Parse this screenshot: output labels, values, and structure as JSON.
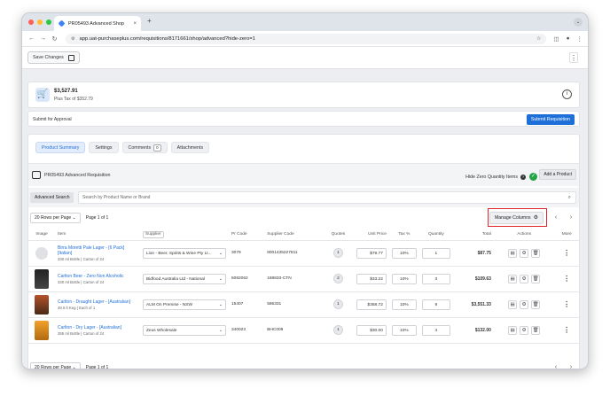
{
  "browser": {
    "tab_title": "PR05493 Advanced Shop",
    "tab_close": "×",
    "new_tab": "+",
    "url": "app.uat-purchaseplus.com/requisitions/8171661/shop/advanced?hide-zero=1"
  },
  "topbar": {
    "save_label": "Save Changes",
    "menu": "⋮"
  },
  "summary": {
    "amount": "$3,527.91",
    "tax": "Plus Tax of $352.79",
    "info": "i"
  },
  "approval": {
    "label": "Submit for Approval",
    "submit_label": "Submit Requisition"
  },
  "tabs": [
    {
      "label": "Product Summary"
    },
    {
      "label": "Settings"
    },
    {
      "label": "Comments",
      "badge": "0"
    },
    {
      "label": "Attachments"
    }
  ],
  "requisition": {
    "title": "PR05493 Advanced Requisition",
    "hide_zero_label": "Hide Zero Quantity Items",
    "add_product_label": "Add a Product"
  },
  "search": {
    "advanced_label": "Advanced Search",
    "placeholder": "Search by Product Name or Brand"
  },
  "pager": {
    "rows_label": "20 Rows per Page",
    "page_label": "Page 1 of 1",
    "manage_columns_label": "Manage Columns"
  },
  "columns": {
    "image": "Image",
    "item": "Item",
    "supplier": "Supplier",
    "pr_code": "Pr Code",
    "supplier_code": "Supplier Code",
    "quotes": "Quotes",
    "unit_price": "Unit Price",
    "tax": "Tax %",
    "quantity": "Quantity",
    "total": "Total",
    "actions": "Actions",
    "more": "More"
  },
  "rows": [
    {
      "name": "Birra Moretti Pale Lager - [6 Pack] [Italian]",
      "sub": "330 ml Bottle | Carton of 24",
      "supplier": "Lion - Beer, Spirits & Wine Pty Lt...",
      "pr_code": "3079",
      "supplier_code": "8001435227811",
      "quotes": "1",
      "unit_price": "$79.77",
      "tax": "10%",
      "quantity": "1",
      "total": "$87.75"
    },
    {
      "name": "Carlton Beer - Zero Non Alcoholic",
      "sub": "330 ml Bottle | Carton of 24",
      "supplier": "Bidfood Australia Ltd - National",
      "pr_code": "5082062",
      "supplier_code": "188833-CTN",
      "quotes": "2",
      "unit_price": "$33.22",
      "tax": "10%",
      "quantity": "3",
      "total": "$109.63"
    },
    {
      "name": "Carlton - Draught Lager - [Australian]",
      "sub": "49.5 lt Keg | Each of 1",
      "supplier": "ALM On Premise - NSW",
      "pr_code": "15407",
      "supplier_code": "586331",
      "quotes": "1",
      "unit_price": "$358.72",
      "tax": "10%",
      "quantity": "9",
      "total": "$3,551.33"
    },
    {
      "name": "Carlton - Dry Lager - [Australian]",
      "sub": "355 ml Bottle | Carton of 24",
      "supplier": "Zeus Wholesale",
      "pr_code": "340023",
      "supplier_code": "BHC009",
      "quotes": "1",
      "unit_price": "$30.00",
      "tax": "10%",
      "quantity": "4",
      "total": "$132.00"
    }
  ]
}
